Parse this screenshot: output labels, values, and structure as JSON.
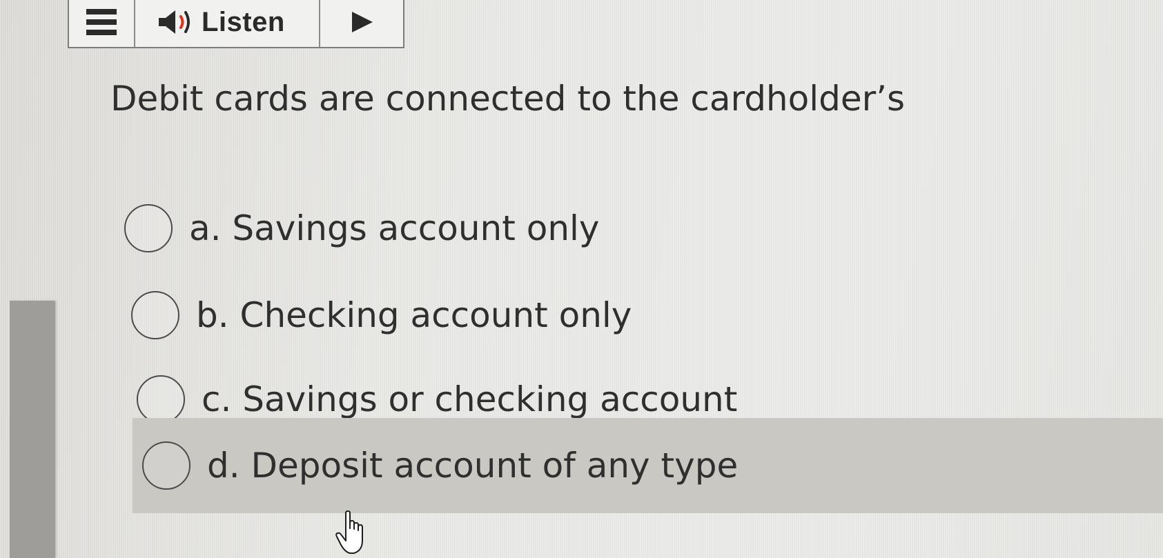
{
  "toolbar": {
    "menu_icon": "hamburger-menu-icon",
    "speaker_icon": "speaker-icon",
    "listen_label": "Listen",
    "play_icon": "play-icon"
  },
  "question": {
    "text": "Debit cards are connected to the cardholder’s"
  },
  "options": [
    {
      "label": "a. Savings account only"
    },
    {
      "label": "b. Checking account only"
    },
    {
      "label": "c. Savings or checking account"
    },
    {
      "label": "d. Deposit account of any type"
    }
  ],
  "cursor": {
    "icon": "hand-pointer-icon"
  }
}
